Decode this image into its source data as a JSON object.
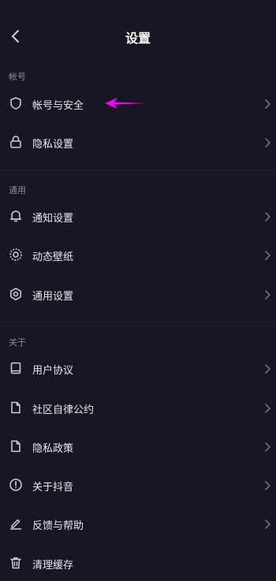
{
  "header": {
    "title": "设置"
  },
  "sections": [
    {
      "label": "帐号",
      "items": [
        {
          "label": "帐号与安全",
          "icon": "shield-icon"
        },
        {
          "label": "隐私设置",
          "icon": "lock-icon"
        }
      ]
    },
    {
      "label": "通用",
      "items": [
        {
          "label": "通知设置",
          "icon": "bell-icon"
        },
        {
          "label": "动态壁纸",
          "icon": "wallpaper-icon"
        },
        {
          "label": "通用设置",
          "icon": "gear-icon"
        }
      ]
    },
    {
      "label": "关于",
      "items": [
        {
          "label": "用户协议",
          "icon": "book-icon"
        },
        {
          "label": "社区自律公约",
          "icon": "document-icon"
        },
        {
          "label": "隐私政策",
          "icon": "document-icon"
        },
        {
          "label": "关于抖音",
          "icon": "info-icon"
        },
        {
          "label": "反馈与帮助",
          "icon": "pen-icon"
        },
        {
          "label": "清理缓存",
          "icon": "trash-icon"
        }
      ]
    }
  ],
  "colors": {
    "background": "#161723",
    "annotation_arrow": "#ff00ff",
    "icon": "#cfd0d8",
    "chevron": "#6f707a"
  }
}
